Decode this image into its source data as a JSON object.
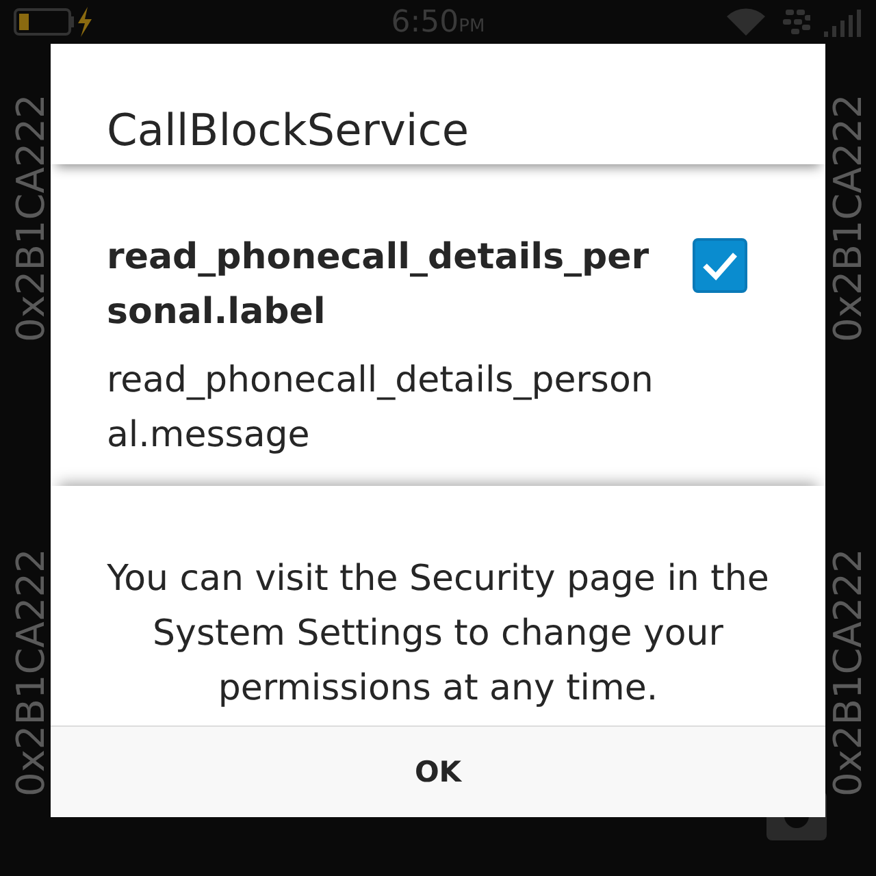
{
  "status_bar": {
    "time": "6:50",
    "meridiem": "PM",
    "charging": true
  },
  "side_labels": [
    "0x2B1CA222",
    "0x2B1CA222",
    "0x2B1CA222",
    "0x2B1CA222"
  ],
  "dialog": {
    "title": "CallBlockService",
    "permissions": [
      {
        "label": "read_phonecall_details_personal.label",
        "message": "read_phonecall_details_personal.message",
        "checked": true
      }
    ],
    "notice": "You can visit the Security page in the System Settings to change your permissions at any time.",
    "button": "OK"
  }
}
